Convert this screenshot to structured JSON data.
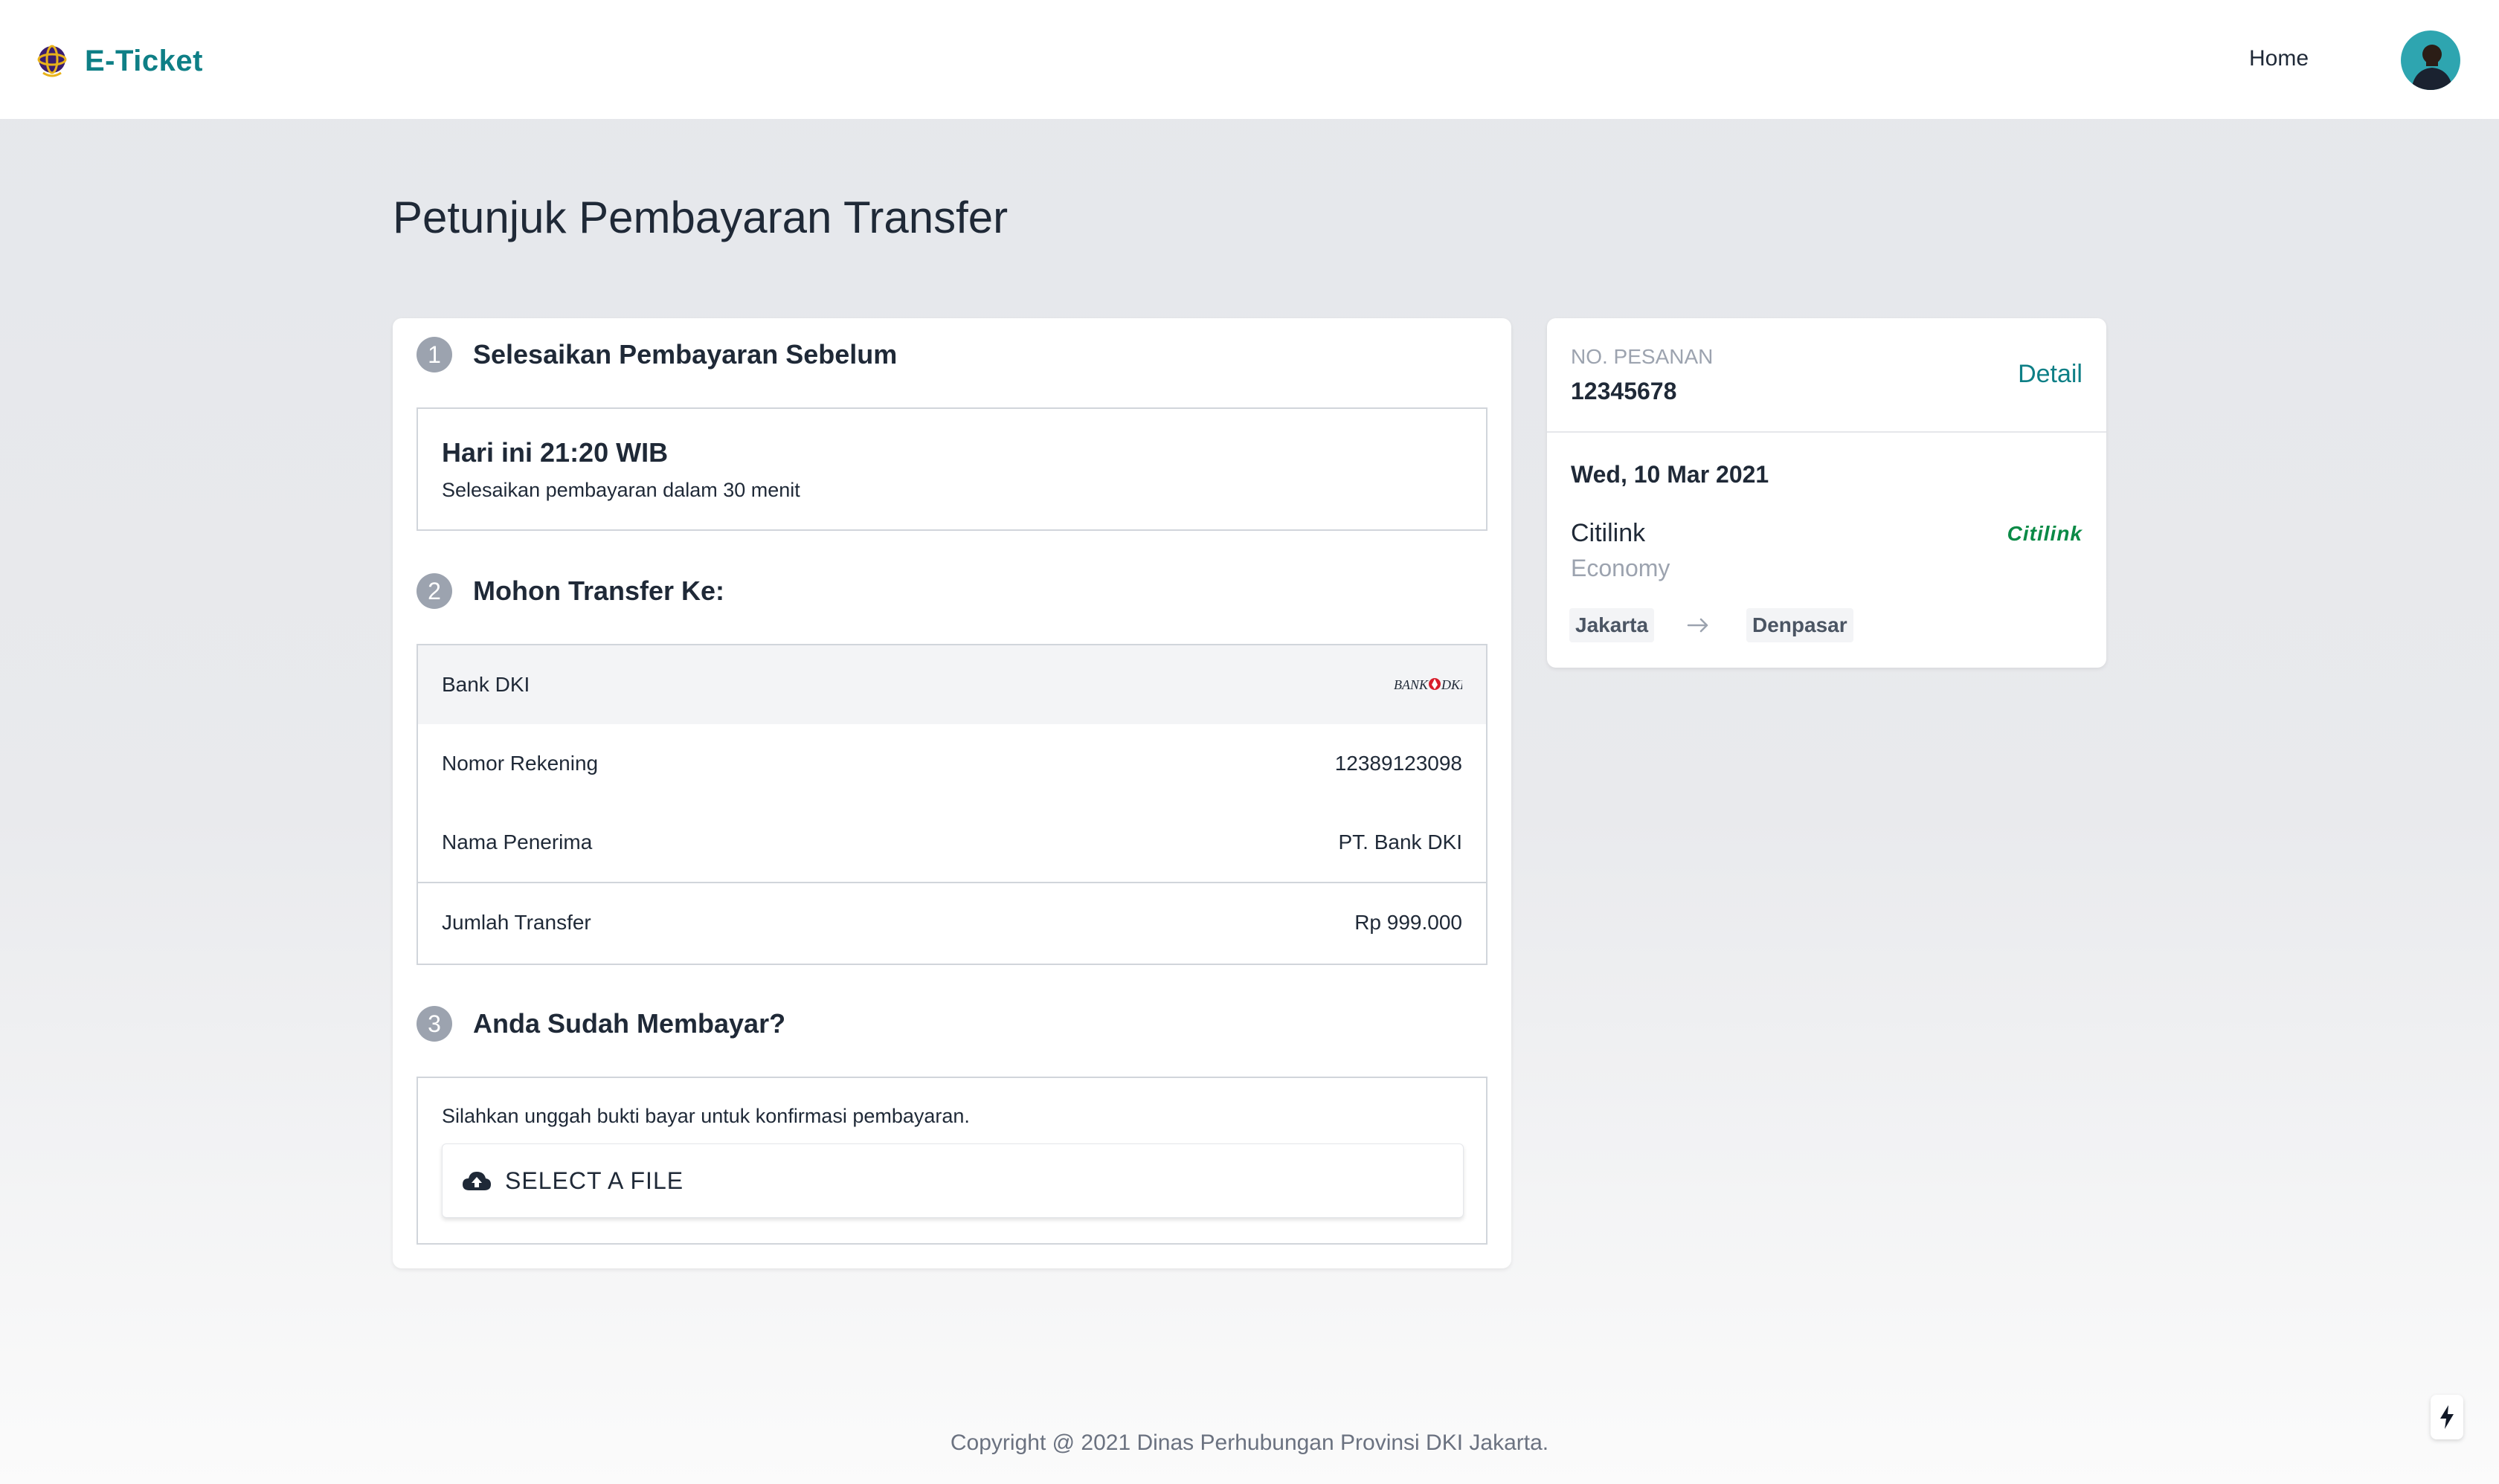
{
  "navbar": {
    "brand": "E-Ticket",
    "home": "Home",
    "avatar_alt": "user-avatar"
  },
  "page_title": "Petunjuk Pembayaran Transfer",
  "steps": [
    {
      "number": "1",
      "title": "Selesaikan Pembayaran Sebelum"
    },
    {
      "number": "2",
      "title": "Mohon Transfer Ke:"
    },
    {
      "number": "3",
      "title": "Anda Sudah Membayar?"
    }
  ],
  "deadline": {
    "time": "Hari ini 21:20 WIB",
    "note": "Selesaikan pembayaran dalam 30 menit"
  },
  "transfer": {
    "bank_name": "Bank DKI",
    "bank_logo_text": "BANK DKI",
    "rows": [
      {
        "label": "Nomor Rekening",
        "value": "12389123098"
      },
      {
        "label": "Nama Penerima",
        "value": "PT. Bank DKI"
      }
    ],
    "amount": {
      "label": "Jumlah Transfer",
      "value": "Rp 999.000"
    }
  },
  "upload": {
    "note": "Silahkan unggah bukti bayar untuk konfirmasi pembayaran.",
    "button": "SELECT A FILE"
  },
  "order": {
    "label": "NO. PESANAN",
    "number": "12345678",
    "detail_link": "Detail",
    "date": "Wed, 10 Mar 2021",
    "airline": "Citilink",
    "airline_logo": "Citilink",
    "cabin": "Economy",
    "origin": "Jakarta",
    "destination": "Denpasar"
  },
  "footer": "Copyright @ 2021 Dinas Perhubungan Provinsi DKI Jakarta.",
  "colors": {
    "brand": "#0e7f86",
    "background": "#e5e7eb",
    "step_badge": "#9ca3af",
    "airline_green": "#0a8a46"
  }
}
